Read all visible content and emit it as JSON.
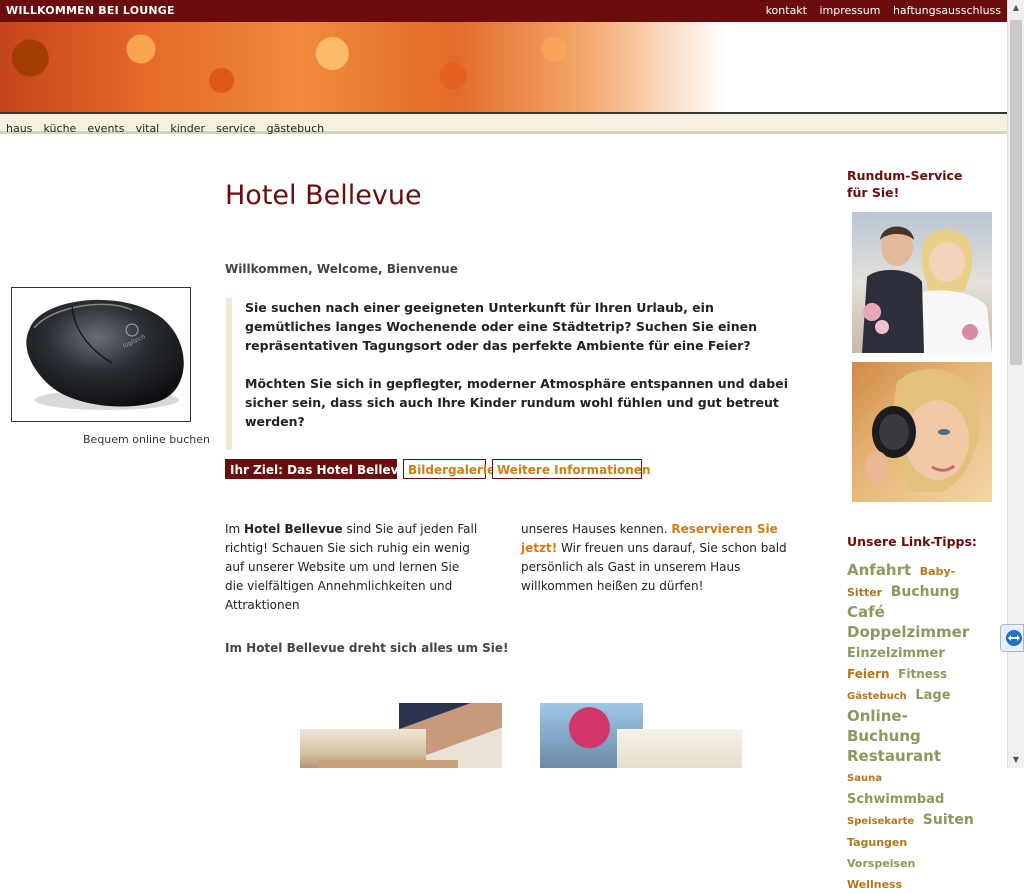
{
  "header": {
    "site_title": "WILLKOMMEN BEI LOUNGE",
    "links": [
      "kontakt",
      "impressum",
      "haftungsausschluss"
    ]
  },
  "nav": {
    "items": [
      "haus",
      "küche",
      "events",
      "vital",
      "kinder",
      "service",
      "gästebuch"
    ]
  },
  "left": {
    "caption": "Bequem online buchen"
  },
  "main": {
    "title": "Hotel Bellevue",
    "welcome": "Willkommen, Welcome, Bienvenue",
    "intro_p1": "Sie suchen nach einer geeigneten Unterkunft für Ihren Urlaub, ein gemütliches langes Wochenende oder eine Städtetrip? Suchen Sie einen repräsentativen Tagungsort oder das perfekte Ambiente für eine Feier?",
    "intro_p2": "Möchten Sie sich in gepflegter, moderner Atmosphäre entspannen und dabei sicher sein, dass sich auch Ihre Kinder rundum wohl fühlen und gut betreut werden?",
    "tabs": [
      "Ihr Ziel: Das Hotel Bellevue",
      "Bildergalerie",
      "Weitere Informationen"
    ],
    "col1_prefix": "Im ",
    "col1_bold": "Hotel Bellevue",
    "col1_rest": " sind Sie auf jeden Fall richtig! Schauen Sie sich ruhig ein wenig auf unserer Website um und lernen Sie die vielfältigen Annehmlichkeiten und Attraktionen",
    "col2_prefix": "unseres Hauses kennen. ",
    "col2_link": "Reservieren Sie jetzt!",
    "col2_rest": " Wir freuen uns darauf, Sie schon bald persönlich als Gast in unserem Haus willkommen heißen zu dürfen!",
    "tagline": "Im Hotel Bellevue dreht sich alles um Sie!"
  },
  "sidebar": {
    "service_title": "Rundum-Service für Sie!",
    "links_title": "Unsere Link-Tipps:",
    "tags": [
      {
        "text": "Anfahrt",
        "size": 15,
        "color": "#8a9a5b"
      },
      {
        "text": "Baby-Sitter",
        "size": 11,
        "color": "#b5761a"
      },
      {
        "text": "Buchung",
        "size": 14,
        "color": "#8a9a5b"
      },
      {
        "text": "Café",
        "size": 15,
        "color": "#8a9a5b"
      },
      {
        "text": "Doppelzimmer",
        "size": 15,
        "color": "#8a9a5b"
      },
      {
        "text": "Einzelzimmer",
        "size": 13,
        "color": "#8a9a5b"
      },
      {
        "text": "Feiern",
        "size": 12,
        "color": "#b5761a"
      },
      {
        "text": "Fitness",
        "size": 12,
        "color": "#8a9a5b"
      },
      {
        "text": "Gästebuch",
        "size": 10,
        "color": "#b5761a"
      },
      {
        "text": "Lage",
        "size": 13,
        "color": "#8a9a5b"
      },
      {
        "text": "Online-Buchung",
        "size": 15,
        "color": "#8a9a5b"
      },
      {
        "text": "Restaurant",
        "size": 15,
        "color": "#8a9a5b"
      },
      {
        "text": "Sauna",
        "size": 10,
        "color": "#b5761a"
      },
      {
        "text": "Schwimmbad",
        "size": 13,
        "color": "#8a9a5b"
      },
      {
        "text": "Speisekarte",
        "size": 10,
        "color": "#b5761a"
      },
      {
        "text": "Suiten",
        "size": 14,
        "color": "#8a9a5b"
      },
      {
        "text": "Tagungen",
        "size": 11,
        "color": "#b5761a"
      },
      {
        "text": "Vorspeisen",
        "size": 11,
        "color": "#8a9a5b"
      },
      {
        "text": "Wellness",
        "size": 11,
        "color": "#b5761a"
      }
    ]
  },
  "colors": {
    "brand_dark_red": "#6b0d0d",
    "accent_orange": "#d27d14",
    "tag_green": "#8a9a5b"
  }
}
